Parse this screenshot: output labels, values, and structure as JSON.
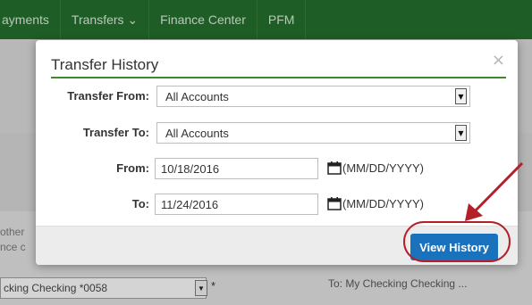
{
  "nav": {
    "items": [
      "ayments",
      "Transfers ⌄",
      "Finance Center",
      "PFM"
    ]
  },
  "background": {
    "left_text_1": "other",
    "left_text_2": "nce c",
    "from_select_value": "cking Checking *0058",
    "asterisk": "*",
    "to_text": "To: My Checking Checking ..."
  },
  "modal": {
    "title": "Transfer History",
    "close_glyph": "×",
    "transfer_from": {
      "label": "Transfer From:",
      "value": "All Accounts"
    },
    "transfer_to": {
      "label": "Transfer To:",
      "value": "All Accounts"
    },
    "from_date": {
      "label": "From:",
      "value": "10/18/2016",
      "format": "(MM/DD/YYYY)"
    },
    "to_date": {
      "label": "To:",
      "value": "11/24/2016",
      "format": "(MM/DD/YYYY)"
    },
    "view_history_label": "View History"
  },
  "colors": {
    "nav_bg": "#236b2c",
    "accent_rule": "#3b8a2c",
    "button_blue": "#1a72bd",
    "highlight_red": "#b3202a"
  },
  "icons": {
    "calendar": "calendar-icon",
    "close": "close-icon",
    "dropdown": "chevron-down-icon"
  }
}
